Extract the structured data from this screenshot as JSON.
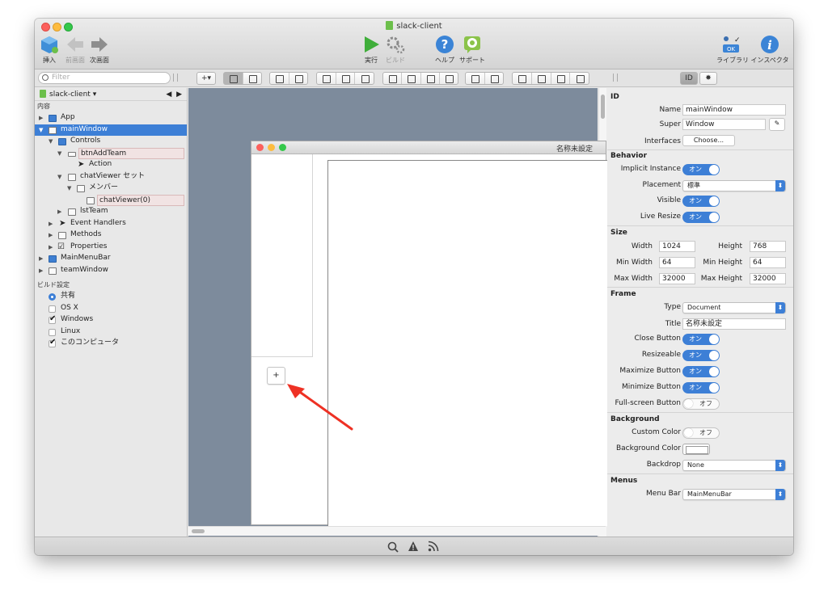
{
  "window": {
    "title": "slack-client",
    "traffic_lights": [
      "#fc605c",
      "#fdbc40",
      "#34c84a"
    ]
  },
  "toolbar": {
    "insert": "挿入",
    "prev": "前画面",
    "next": "次画面",
    "run": "実行",
    "build": "ビルド",
    "help": "ヘルプ",
    "support": "サポート",
    "library": "ライブラリ",
    "inspector": "インスペクタ"
  },
  "search": {
    "placeholder": "Filter"
  },
  "navigator": {
    "project": "slack-client",
    "contents_header": "内容",
    "items": [
      {
        "label": "App"
      },
      {
        "label": "mainWindow"
      },
      {
        "label": "Controls"
      },
      {
        "label": "btnAddTeam"
      },
      {
        "label": "Action"
      },
      {
        "label": "chatViewer セット"
      },
      {
        "label": "メンバー"
      },
      {
        "label": "chatViewer(0)"
      },
      {
        "label": "lstTeam"
      },
      {
        "label": "Event Handlers"
      },
      {
        "label": "Methods"
      },
      {
        "label": "Properties"
      },
      {
        "label": "MainMenuBar"
      },
      {
        "label": "teamWindow"
      }
    ],
    "build_header": "ビルド設定",
    "build_items": [
      {
        "label": "共有",
        "checked": true
      },
      {
        "label": "OS X",
        "checked": false
      },
      {
        "label": "Windows",
        "checked": true
      },
      {
        "label": "Linux",
        "checked": false
      },
      {
        "label": "このコンピュータ",
        "checked": true
      }
    ]
  },
  "canvas": {
    "window_title": "名称未設定",
    "add_button": "+",
    "background": "#7d8b9c"
  },
  "inspector": {
    "id_header": "ID",
    "name_label": "Name",
    "name_value": "mainWindow",
    "super_label": "Super",
    "super_value": "Window",
    "interfaces_label": "Interfaces",
    "interfaces_button": "Choose...",
    "behavior_header": "Behavior",
    "implicit_label": "Implicit Instance",
    "implicit_value": "オン",
    "placement_label": "Placement",
    "placement_value": "標準",
    "visible_label": "Visible",
    "visible_value": "オン",
    "liveresize_label": "Live Resize",
    "liveresize_value": "オン",
    "size_header": "Size",
    "width_label": "Width",
    "width_value": "1024",
    "height_label": "Height",
    "height_value": "768",
    "minwidth_label": "Min Width",
    "minwidth_value": "64",
    "minheight_label": "Min Height",
    "minheight_value": "64",
    "maxwidth_label": "Max Width",
    "maxwidth_value": "32000",
    "maxheight_label": "Max Height",
    "maxheight_value": "32000",
    "frame_header": "Frame",
    "type_label": "Type",
    "type_value": "Document",
    "title_label": "Title",
    "title_value": "名称未設定",
    "close_label": "Close Button",
    "close_value": "オン",
    "resizeable_label": "Resizeable",
    "resizeable_value": "オン",
    "maximize_label": "Maximize Button",
    "maximize_value": "オン",
    "minimize_label": "Minimize Button",
    "minimize_value": "オン",
    "fullscreen_label": "Full-screen Button",
    "fullscreen_value": "オフ",
    "background_header": "Background",
    "customcolor_label": "Custom Color",
    "customcolor_value": "オフ",
    "bgcolor_label": "Background Color",
    "backdrop_label": "Backdrop",
    "backdrop_value": "None",
    "menus_header": "Menus",
    "menubar_label": "Menu Bar",
    "menubar_value": "MainMenuBar"
  },
  "accent_color": "#3d7fd6",
  "annotation_arrow_color": "#ee3124"
}
